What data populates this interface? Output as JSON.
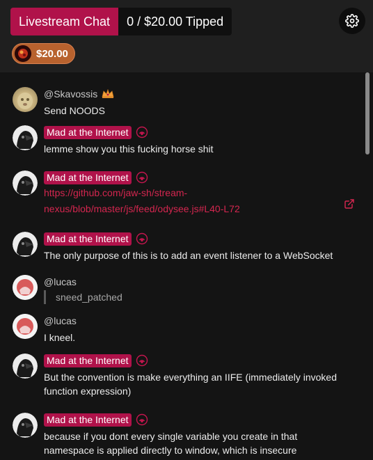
{
  "header": {
    "title": "Livestream Chat",
    "tipped": "0 / $20.00 Tipped",
    "tip_chip_amount": "$20.00"
  },
  "colors": {
    "accent": "#b0124a",
    "chip": "#b8622e",
    "link": "#d4264f"
  },
  "messages": [
    {
      "author": "@Skavossis",
      "badge": "crown-badge-icon",
      "text": "Send NOODS"
    },
    {
      "author": "Mad at the Internet",
      "badge": "broadcast-icon",
      "text": "lemme show you this fucking horse shit"
    },
    {
      "author": "Mad at the Internet",
      "badge": "broadcast-icon",
      "link_line1": "https://github.com/jaw-sh/stream-",
      "link_line2": "nexus/blob/master/js/feed/odysee.js#L40-L72"
    },
    {
      "author": "Mad at the Internet",
      "badge": "broadcast-icon",
      "text": "The only purpose of this is to add an event listener to a WebSocket"
    },
    {
      "author": "@lucas",
      "quote": "sneed_patched"
    },
    {
      "author": "@lucas",
      "text": "I kneel."
    },
    {
      "author": "Mad at the Internet",
      "badge": "broadcast-icon",
      "text_line1": "But the convention is make everything an IIFE (immediately invoked",
      "text_line2": "function expression)"
    },
    {
      "author": "Mad at the Internet",
      "badge": "broadcast-icon",
      "text_line1": "because if you dont every single variable you create in that",
      "text_line2": "namespace is applied directly to window, which is insecure"
    }
  ]
}
